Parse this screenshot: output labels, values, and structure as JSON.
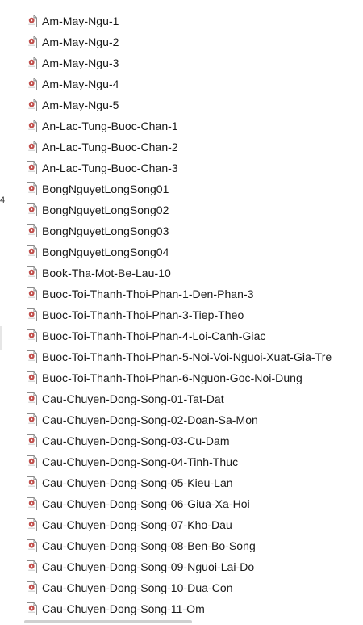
{
  "gutter": {
    "mark": "4"
  },
  "files": [
    {
      "name": "Am-May-Ngu-1",
      "icon": "audio-file-icon"
    },
    {
      "name": "Am-May-Ngu-2",
      "icon": "audio-file-icon"
    },
    {
      "name": "Am-May-Ngu-3",
      "icon": "audio-file-icon"
    },
    {
      "name": "Am-May-Ngu-4",
      "icon": "audio-file-icon"
    },
    {
      "name": "Am-May-Ngu-5",
      "icon": "audio-file-icon"
    },
    {
      "name": "An-Lac-Tung-Buoc-Chan-1",
      "icon": "audio-file-icon"
    },
    {
      "name": "An-Lac-Tung-Buoc-Chan-2",
      "icon": "audio-file-icon"
    },
    {
      "name": "An-Lac-Tung-Buoc-Chan-3",
      "icon": "audio-file-icon"
    },
    {
      "name": "BongNguyetLongSong01",
      "icon": "audio-file-icon"
    },
    {
      "name": "BongNguyetLongSong02",
      "icon": "audio-file-icon"
    },
    {
      "name": "BongNguyetLongSong03",
      "icon": "audio-file-icon"
    },
    {
      "name": "BongNguyetLongSong04",
      "icon": "audio-file-icon"
    },
    {
      "name": "Book-Tha-Mot-Be-Lau-10",
      "icon": "audio-file-icon"
    },
    {
      "name": "Buoc-Toi-Thanh-Thoi-Phan-1-Den-Phan-3",
      "icon": "audio-file-icon"
    },
    {
      "name": "Buoc-Toi-Thanh-Thoi-Phan-3-Tiep-Theo",
      "icon": "audio-file-icon"
    },
    {
      "name": "Buoc-Toi-Thanh-Thoi-Phan-4-Loi-Canh-Giac",
      "icon": "audio-file-icon"
    },
    {
      "name": "Buoc-Toi-Thanh-Thoi-Phan-5-Noi-Voi-Nguoi-Xuat-Gia-Tre",
      "icon": "audio-file-icon"
    },
    {
      "name": "Buoc-Toi-Thanh-Thoi-Phan-6-Nguon-Goc-Noi-Dung",
      "icon": "audio-file-icon"
    },
    {
      "name": "Cau-Chuyen-Dong-Song-01-Tat-Dat",
      "icon": "audio-file-icon"
    },
    {
      "name": "Cau-Chuyen-Dong-Song-02-Doan-Sa-Mon",
      "icon": "audio-file-icon"
    },
    {
      "name": "Cau-Chuyen-Dong-Song-03-Cu-Dam",
      "icon": "audio-file-icon"
    },
    {
      "name": "Cau-Chuyen-Dong-Song-04-Tinh-Thuc",
      "icon": "audio-file-icon"
    },
    {
      "name": "Cau-Chuyen-Dong-Song-05-Kieu-Lan",
      "icon": "audio-file-icon"
    },
    {
      "name": "Cau-Chuyen-Dong-Song-06-Giua-Xa-Hoi",
      "icon": "audio-file-icon"
    },
    {
      "name": "Cau-Chuyen-Dong-Song-07-Kho-Dau",
      "icon": "audio-file-icon"
    },
    {
      "name": "Cau-Chuyen-Dong-Song-08-Ben-Bo-Song",
      "icon": "audio-file-icon"
    },
    {
      "name": "Cau-Chuyen-Dong-Song-09-Nguoi-Lai-Do",
      "icon": "audio-file-icon"
    },
    {
      "name": "Cau-Chuyen-Dong-Song-10-Dua-Con",
      "icon": "audio-file-icon"
    },
    {
      "name": "Cau-Chuyen-Dong-Song-11-Om",
      "icon": "audio-file-icon"
    }
  ],
  "colors": {
    "icon_page": "#ffffff",
    "icon_border": "#8a8a8a",
    "icon_fold": "#d8d8d8",
    "icon_disc": "#c0504d",
    "text": "#1a1a1a"
  }
}
